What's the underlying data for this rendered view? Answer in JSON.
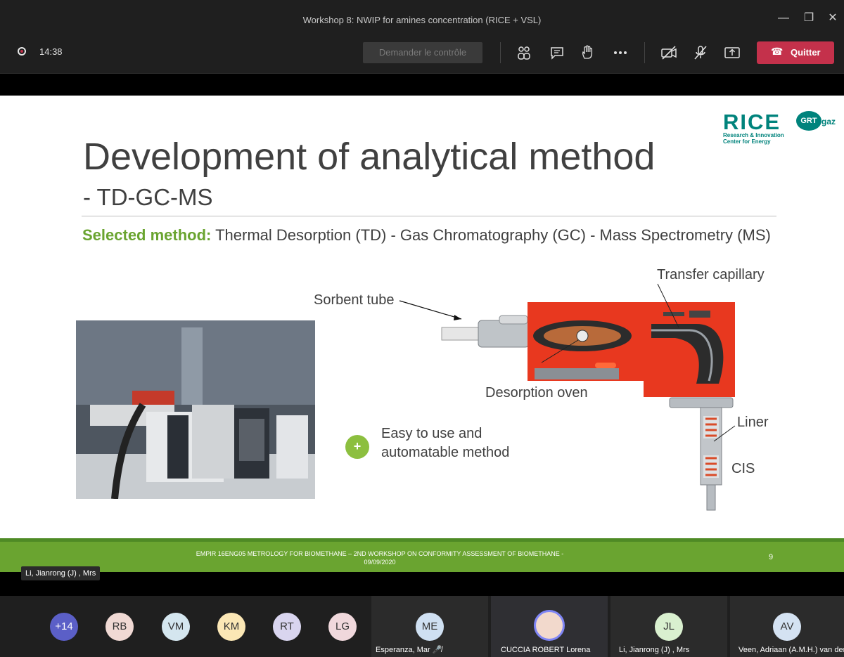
{
  "window": {
    "title": "Workshop 8: NWIP for amines concentration (RICE + VSL)"
  },
  "toolbar": {
    "timer": "14:38",
    "request_control_label": "Demander le contrôle",
    "leave_label": "Quitter",
    "leave_color": "#c4314b"
  },
  "slide": {
    "logo": {
      "wordmark": "RICE",
      "grt": "GRT",
      "gaz": "gaz",
      "tagline_1": "Research & Innovation",
      "tagline_2": "Center for Energy"
    },
    "title": "Development of analytical method",
    "subtitle": "- TD-GC-MS",
    "method_label": "Selected method:",
    "method_text": " Thermal Desorption (TD) - Gas Chromatography (GC) -  Mass Spectrometry (MS)",
    "plus_symbol": "+",
    "plus_line_1": "Easy to use and",
    "plus_line_2": "automatable method",
    "diagram_labels": {
      "sorbent_tube": "Sorbent tube",
      "transfer_capillary": "Transfer capillary",
      "desorption_oven": "Desorption oven",
      "liner": "Liner",
      "cis": "CIS"
    },
    "footer_line_1": "EMPIR 16ENG05 METROLOGY FOR BIOMETHANE – 2ND WORKSHOP ON CONFORMITY ASSESSMENT OF BIOMETHANE -",
    "footer_line_2": "09/09/2020",
    "page_number": "9",
    "accent_color": "#6aa430",
    "brand_color": "#00837c"
  },
  "presenter_name": "Li, Jianrong (J) , Mrs",
  "participants": {
    "overflow": "+14",
    "avatars": [
      "RB",
      "VM",
      "KM",
      "RT",
      "LG"
    ],
    "tiles": [
      {
        "initials": "ME",
        "name": "Esperanza, Mar"
      },
      {
        "initials": "",
        "name": "CUCCIA ROBERT Lorena"
      },
      {
        "initials": "JL",
        "name": "Li, Jianrong (J) , Mrs"
      },
      {
        "initials": "AV",
        "name": "Veen, Adriaan (A.M.H.) van der"
      }
    ]
  }
}
